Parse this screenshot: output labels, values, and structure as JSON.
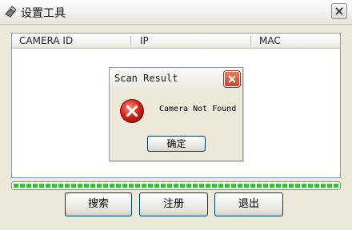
{
  "window": {
    "title": "设置工具"
  },
  "table": {
    "columns": [
      "CAMERA ID",
      "IP",
      "MAC"
    ]
  },
  "progress": {
    "value_fraction": 1.0,
    "color": "#2fc52f"
  },
  "buttons": {
    "search": "搜索",
    "register": "注册",
    "exit": "退出"
  },
  "dialog": {
    "title": "Scan Result",
    "message": "Camera Not Found",
    "ok_label": "确定",
    "close_color": "#c9432a",
    "icon": "error-icon"
  }
}
